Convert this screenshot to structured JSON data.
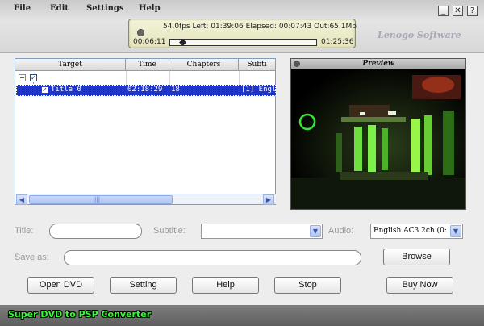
{
  "menu": {
    "file": "File",
    "edit": "Edit",
    "settings": "Settings",
    "help": "Help"
  },
  "window_controls": {
    "minimize": "_",
    "close": "✕",
    "help": "?"
  },
  "status": {
    "line": "54.0fps Left: 01:39:06 Elapsed: 00:07:43 Out:65.1Mb",
    "position": "00:06:11",
    "duration": "01:25:36",
    "progress_fraction": 0.07
  },
  "brand": "Lenogo Software",
  "table": {
    "columns": [
      "Target",
      "Time",
      "Chapters",
      "Subti"
    ],
    "rows": [
      {
        "title": "Title 0",
        "time": "02:18:29",
        "chapters": "18",
        "subtitle": "[1] Engl"
      }
    ]
  },
  "scroll": {
    "left": "◀",
    "right": "▶",
    "grip": "|||"
  },
  "preview": {
    "title": "Preview"
  },
  "form": {
    "title_label": "Title:",
    "title_value": "",
    "subtitle_label": "Subtitle:",
    "subtitle_value": "",
    "audio_label": "Audio:",
    "audio_value": "English AC3 2ch (0:",
    "save_as_label": "Save as:",
    "save_as_value": "",
    "dropdown_arrow": "▼"
  },
  "buttons": {
    "browse": "Browse",
    "open_dvd": "Open DVD",
    "setting": "Setting",
    "help": "Help",
    "stop": "Stop",
    "buy_now": "Buy Now"
  },
  "footer": "Super DVD to PSP Converter",
  "colors": {
    "selection": "#1f35c8",
    "footer_text": "#34ff34"
  }
}
